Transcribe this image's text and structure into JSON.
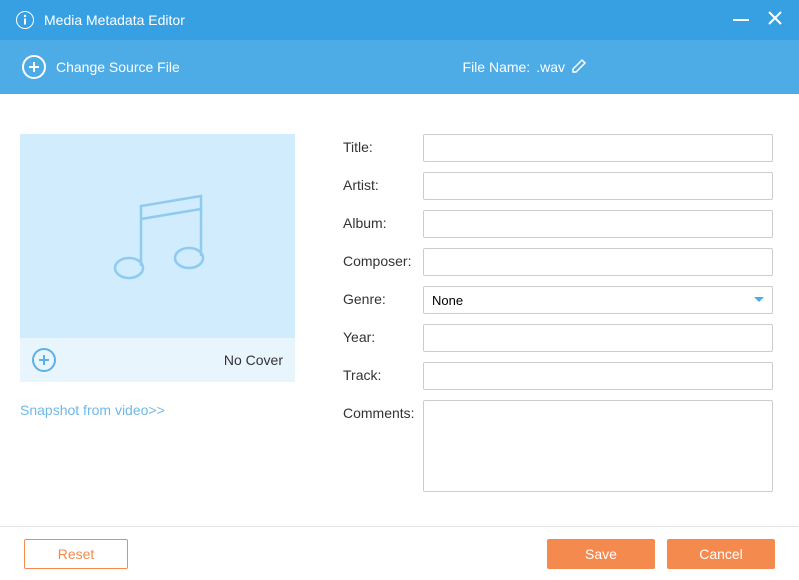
{
  "titlebar": {
    "title": "Media Metadata Editor"
  },
  "toolbar": {
    "change_source_label": "Change Source File",
    "filename_label": "File Name:",
    "filename_value": ".wav"
  },
  "cover": {
    "no_cover_label": "No Cover",
    "snapshot_link": "Snapshot from video>>"
  },
  "fields": {
    "title": {
      "label": "Title:",
      "value": ""
    },
    "artist": {
      "label": "Artist:",
      "value": ""
    },
    "album": {
      "label": "Album:",
      "value": ""
    },
    "composer": {
      "label": "Composer:",
      "value": ""
    },
    "genre": {
      "label": "Genre:",
      "value": "None"
    },
    "year": {
      "label": "Year:",
      "value": ""
    },
    "track": {
      "label": "Track:",
      "value": ""
    },
    "comments": {
      "label": "Comments:",
      "value": ""
    }
  },
  "footer": {
    "reset_label": "Reset",
    "save_label": "Save",
    "cancel_label": "Cancel"
  }
}
